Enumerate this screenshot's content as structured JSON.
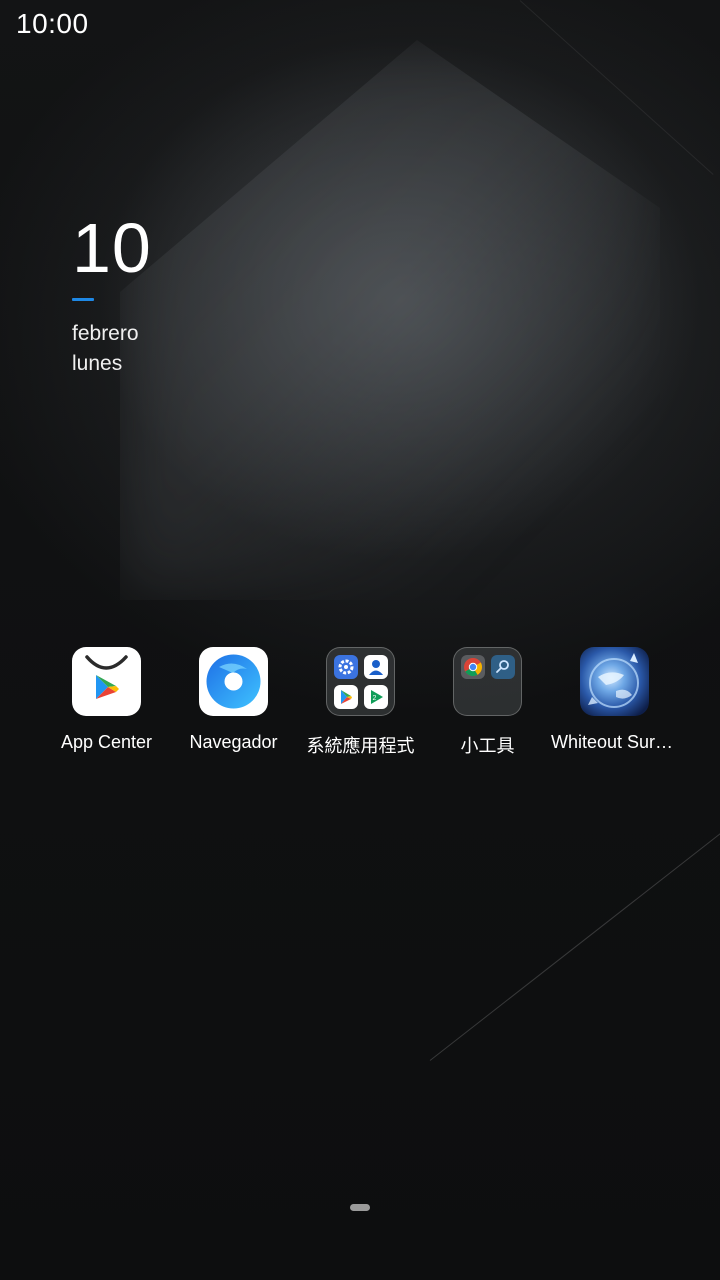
{
  "status_bar": {
    "time": "10:00"
  },
  "clock_widget": {
    "day": "10",
    "month": "febrero",
    "weekday": "lunes",
    "accent_color": "#1e88e5"
  },
  "apps": [
    {
      "label": "App Center",
      "icon": "play-store-bag-icon"
    },
    {
      "label": "Navegador",
      "icon": "browser-icon"
    },
    {
      "label": "系統應用程式",
      "icon": "folder-icon",
      "contents": [
        "settings-icon",
        "contacts-icon",
        "play-store-icon",
        "play-games-icon"
      ]
    },
    {
      "label": "小工具",
      "icon": "folder-icon",
      "contents": [
        "chrome-icon",
        "search-icon"
      ]
    },
    {
      "label": "Whiteout Survi…",
      "icon": "game-globe-icon"
    }
  ]
}
